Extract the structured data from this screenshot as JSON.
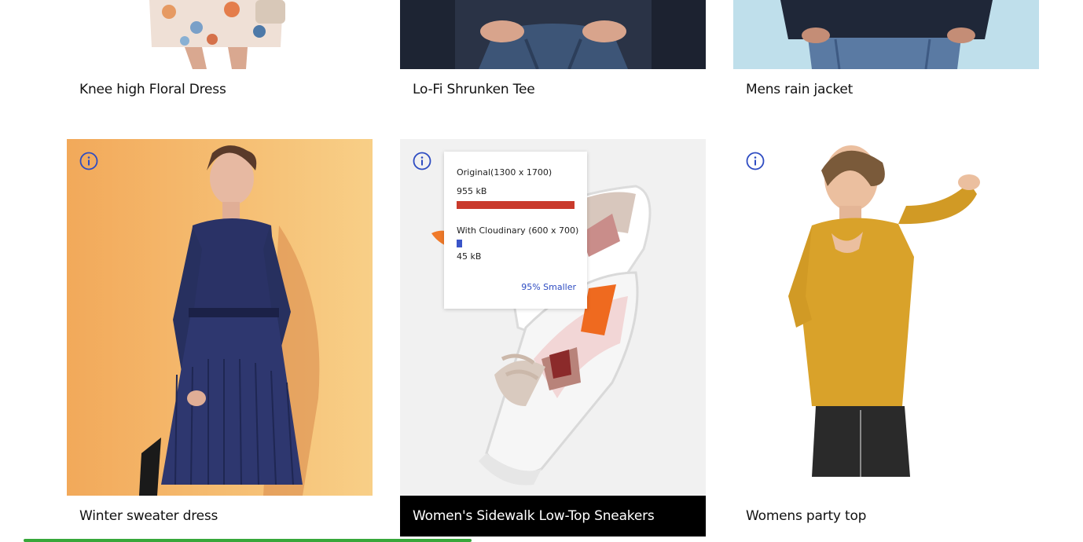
{
  "products": [
    {
      "name": "Knee high Floral Dress"
    },
    {
      "name": "Lo-Fi Shrunken Tee"
    },
    {
      "name": "Mens rain jacket"
    },
    {
      "name": "Winter sweater dress"
    },
    {
      "name": "Women's Sidewalk Low-Top Sneakers"
    },
    {
      "name": "Womens party top"
    }
  ],
  "tooltip": {
    "original_label": "Original(1300 x 1700)",
    "original_size": "955 kB",
    "optimized_label": "With Cloudinary (600 x 700)",
    "optimized_size": "45 kB",
    "savings": "95% Smaller",
    "original_fraction": 1.0,
    "optimized_fraction": 0.047
  },
  "colors": {
    "original_bar": "#c93a2c",
    "optimized_bar": "#3a55c8",
    "savings_text": "#2e4cc2",
    "info_icon": "#2e4cc2",
    "active_caption_bg": "#000000",
    "sweater_bg": "#f5b869"
  },
  "icons": [
    "info-icon"
  ]
}
